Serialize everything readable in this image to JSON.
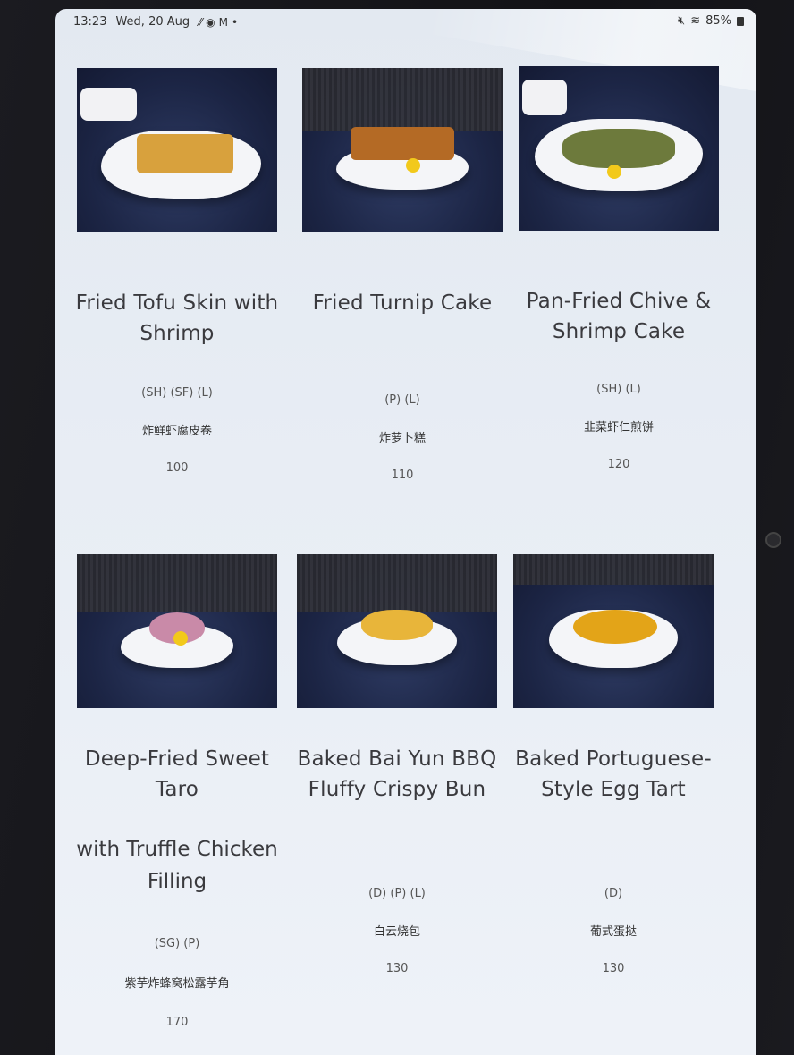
{
  "status_bar": {
    "time": "13:23",
    "date": "Wed, 20 Aug",
    "battery": "85%"
  },
  "menu": {
    "items": [
      {
        "name": "Fried Tofu Skin with Shrimp",
        "name_extra": "",
        "tags": "(SH) (SF) (L)",
        "chinese": "炸鲜虾腐皮卷",
        "price": "100"
      },
      {
        "name": "Fried Turnip Cake",
        "name_extra": "",
        "tags": "(P) (L)",
        "chinese": "炸萝卜糕",
        "price": "110"
      },
      {
        "name": "Pan-Fried Chive & Shrimp Cake",
        "name_extra": "",
        "tags": "(SH) (L)",
        "chinese": "韭菜虾仁煎饼",
        "price": "120"
      },
      {
        "name": "Deep-Fried Sweet Taro",
        "name_extra": "with Truffle Chicken Filling",
        "tags": "(SG) (P)",
        "chinese": "紫芋炸蜂窝松露芋角",
        "price": "170"
      },
      {
        "name": "Baked Bai Yun BBQ Fluffy Crispy Bun",
        "name_extra": "",
        "tags": "(D) (P) (L)",
        "chinese": "白云烧包",
        "price": "130"
      },
      {
        "name": "Baked Portuguese-Style Egg Tart",
        "name_extra": "",
        "tags": "(D)",
        "chinese": "葡式蛋挞",
        "price": "130"
      }
    ]
  }
}
